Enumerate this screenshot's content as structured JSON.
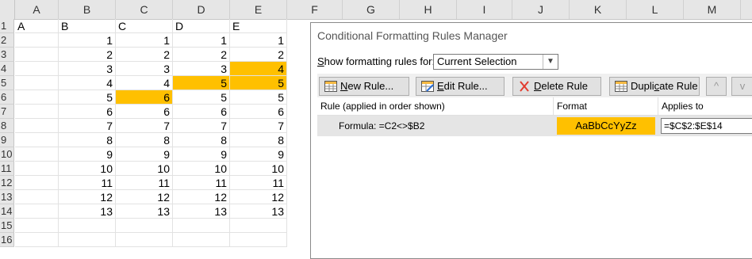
{
  "spreadsheet": {
    "columns": [
      "A",
      "B",
      "C",
      "D",
      "E",
      "F",
      "G",
      "H",
      "I",
      "J",
      "K",
      "L",
      "M"
    ],
    "rows": [
      "1",
      "2",
      "3",
      "4",
      "5",
      "6",
      "7",
      "8",
      "9",
      "10",
      "11",
      "12",
      "13",
      "14",
      "15",
      "16"
    ],
    "header_row": [
      "A",
      "B",
      "C",
      "D",
      "E"
    ],
    "data": [
      [
        1,
        1,
        1,
        1
      ],
      [
        2,
        2,
        2,
        2
      ],
      [
        3,
        3,
        3,
        4
      ],
      [
        4,
        4,
        5,
        5
      ],
      [
        5,
        6,
        5,
        5
      ],
      [
        6,
        6,
        6,
        6
      ],
      [
        7,
        7,
        7,
        7
      ],
      [
        8,
        8,
        8,
        8
      ],
      [
        9,
        9,
        9,
        9
      ],
      [
        10,
        10,
        10,
        10
      ],
      [
        11,
        11,
        11,
        11
      ],
      [
        12,
        12,
        12,
        12
      ],
      [
        13,
        13,
        13,
        13
      ]
    ],
    "highlight_color": "#ffc000"
  },
  "dialog": {
    "title": "Conditional Formatting Rules Manager",
    "show_rules_label_prefix": "S",
    "show_rules_label_rest": "how formatting rules for:",
    "scope_selected": "Current Selection",
    "buttons": {
      "new_rule": {
        "u": "N",
        "rest": "ew Rule..."
      },
      "edit_rule": {
        "u": "E",
        "rest": "dit Rule..."
      },
      "delete_rule": {
        "u": "D",
        "rest": "elete Rule"
      },
      "duplicate_rule": {
        "pre": "Dupli",
        "u": "c",
        "rest": "ate Rule"
      },
      "move_up": "^",
      "move_down": "v"
    },
    "table_headers": {
      "rule": "Rule (applied in order shown)",
      "format": "Format",
      "applies_to": "Applies to"
    },
    "rules": [
      {
        "formula": "Formula: =C2<>$B2",
        "format_preview": "AaBbCcYyZz",
        "applies_to": "=$C$2:$E$14"
      }
    ],
    "icon_names": {
      "new_rule": "table-new-icon",
      "edit_rule": "table-edit-icon",
      "delete_rule": "red-x-icon",
      "duplicate_rule": "table-duplicate-icon"
    }
  }
}
